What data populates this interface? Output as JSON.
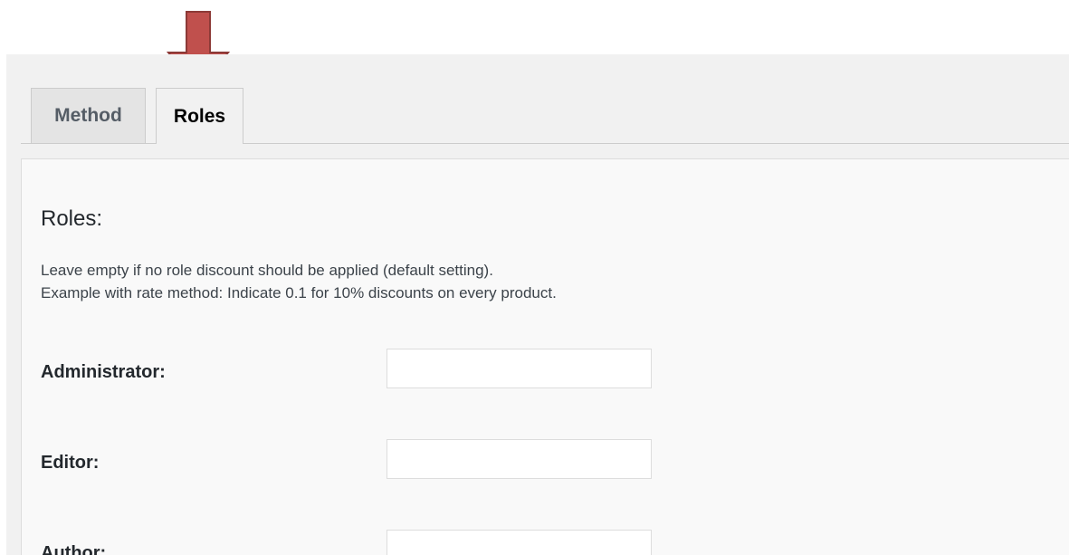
{
  "tabs": [
    {
      "label": "Method",
      "active": false
    },
    {
      "label": "Roles",
      "active": true
    }
  ],
  "annotation": {
    "icon": "down-arrow-icon",
    "color": "#c0504d"
  },
  "roles_section": {
    "title": "Roles:",
    "help_lines": [
      "Leave empty if no role discount should be applied (default setting).",
      "Example with rate method: Indicate 0.1 for 10% discounts on every product."
    ],
    "fields": [
      {
        "label": "Administrator:",
        "value": ""
      },
      {
        "label": "Editor:",
        "value": ""
      },
      {
        "label": "Author:",
        "value": ""
      }
    ]
  }
}
